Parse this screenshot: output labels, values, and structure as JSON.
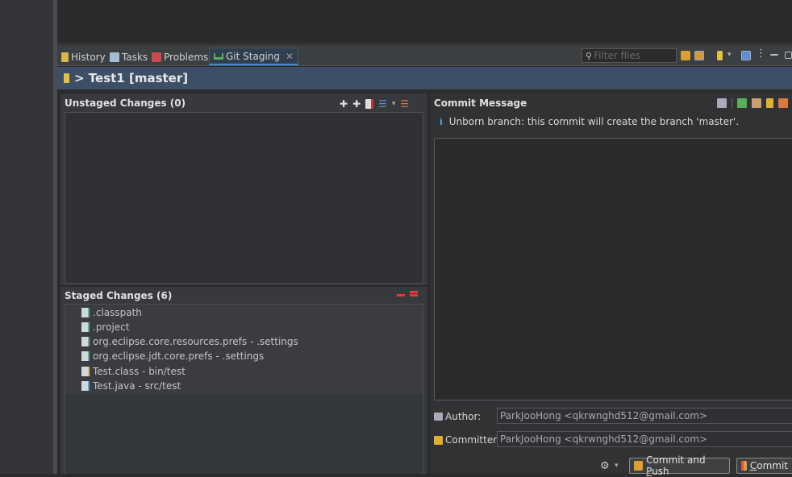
{
  "tabs": [
    {
      "label": "History",
      "icon": "history-icon"
    },
    {
      "label": "Tasks",
      "icon": "tasks-icon"
    },
    {
      "label": "Problems",
      "icon": "problems-icon"
    },
    {
      "label": "Git Staging",
      "icon": "git-staging-icon",
      "active": true
    }
  ],
  "filter": {
    "placeholder": "Filter files"
  },
  "header": {
    "title": "> Test1 [master]"
  },
  "unstaged": {
    "title": "Unstaged Changes (0)"
  },
  "staged": {
    "title": "Staged Changes (6)",
    "files": [
      {
        "name": ".classpath",
        "kind": "x"
      },
      {
        "name": ".project",
        "kind": "x"
      },
      {
        "name": "org.eclipse.core.resources.prefs - .settings",
        "kind": "p"
      },
      {
        "name": "org.eclipse.jdt.core.prefs - .settings",
        "kind": "p"
      },
      {
        "name": "Test.class - bin/test",
        "kind": "c"
      },
      {
        "name": "Test.java - src/test",
        "kind": "j"
      }
    ]
  },
  "commit": {
    "title": "Commit Message",
    "info": "Unborn branch: this commit will create the branch 'master'.",
    "author_label": "Author:",
    "author_value": "ParkJooHong <qkrwnghd512@gmail.com>",
    "committer_label": "Committer:",
    "committer_value": "ParkJooHong <qkrwnghd512@gmail.com>",
    "commit_push_prefix": "Commit and ",
    "commit_push_mnemonic": "P",
    "commit_push_suffix": "ush",
    "commit_mnemonic": "C",
    "commit_suffix": "ommit"
  },
  "colors": {
    "accent": "#3f8fd6",
    "header": "#3c4f66"
  }
}
